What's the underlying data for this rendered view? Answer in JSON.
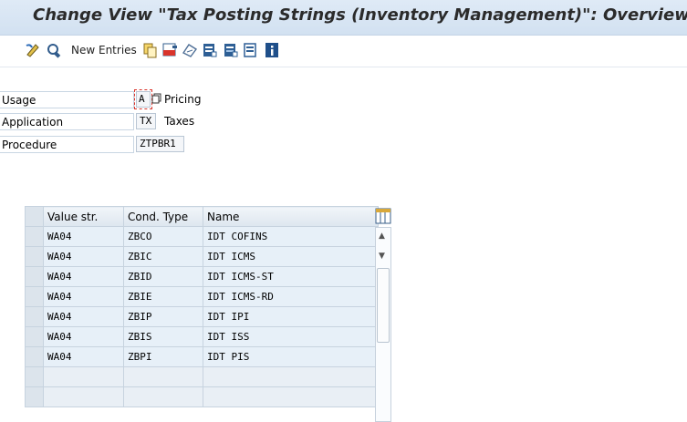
{
  "window": {
    "title": "Change View \"Tax Posting Strings (Inventory Management)\": Overview"
  },
  "toolbar": {
    "new_entries_label": "New Entries",
    "icons": [
      "display-change-icon",
      "other-view-icon",
      "copy-as-icon",
      "delete-icon",
      "undo-change-icon",
      "select-all-icon",
      "select-block-icon",
      "deselect-all-icon",
      "info-icon"
    ]
  },
  "header": {
    "usage": {
      "label": "Usage",
      "value": "A",
      "text": "Pricing"
    },
    "application": {
      "label": "Application",
      "value": "TX",
      "text": "Taxes"
    },
    "procedure": {
      "label": "Procedure",
      "value": "ZTPBR1"
    }
  },
  "table": {
    "columns": [
      "Value str.",
      "Cond. Type",
      "Name"
    ],
    "rows": [
      [
        "WA04",
        "ZBCO",
        "IDT COFINS"
      ],
      [
        "WA04",
        "ZBIC",
        "IDT ICMS"
      ],
      [
        "WA04",
        "ZBID",
        "IDT ICMS-ST"
      ],
      [
        "WA04",
        "ZBIE",
        "IDT ICMS-RD"
      ],
      [
        "WA04",
        "ZBIP",
        "IDT IPI"
      ],
      [
        "WA04",
        "ZBIS",
        "IDT ISS"
      ],
      [
        "WA04",
        "ZBPI",
        "IDT PIS"
      ]
    ]
  },
  "colors": {
    "title_bar": "#d2e1f1",
    "row_fill": "#e7f0f8",
    "accent_red": "#d9342b"
  }
}
